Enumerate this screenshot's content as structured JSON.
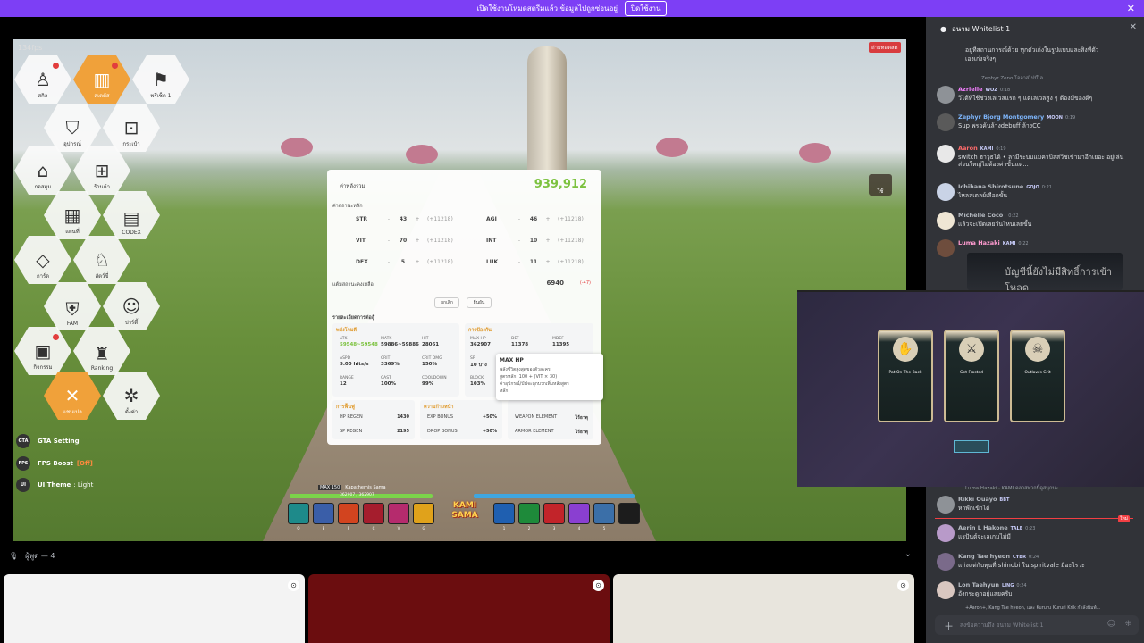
{
  "banner": {
    "text": "เปิดใช้งานโหมดสตรีมแล้ว ข้อมูลไปถูกซ่อนอยู่",
    "button": "ปิดใช้งาน",
    "close": "✕"
  },
  "game": {
    "fps": "134fps",
    "live_badge": "ถ่ายทอดสด",
    "top_right_button": "ใช้",
    "menu": [
      {
        "label": "สกิล",
        "icon": "person-icon",
        "glyph": "♙"
      },
      {
        "label": "สเตตัส",
        "icon": "bar-chart-icon",
        "glyph": "▥",
        "active": true
      },
      {
        "label": "พรีเซ็ต 1",
        "icon": "figure-icon",
        "glyph": "⚑"
      },
      {
        "label": "อุปกรณ์",
        "icon": "shield-icon",
        "glyph": "⛉"
      },
      {
        "label": "กระเป๋า",
        "icon": "bag-icon",
        "glyph": "⊡"
      },
      {
        "label": "กอสตูม",
        "icon": "shirt-icon",
        "glyph": "⌂"
      },
      {
        "label": "ร้านค้า",
        "icon": "shop-bag-icon",
        "glyph": "⊞"
      },
      {
        "label": "แผนที่",
        "icon": "map-icon",
        "glyph": "▦"
      },
      {
        "label": "CODEX",
        "icon": "book-icon",
        "glyph": "▤"
      },
      {
        "label": "การ์ด",
        "icon": "card-icon",
        "glyph": "◇"
      },
      {
        "label": "สัตว์ขี่",
        "icon": "mount-icon",
        "glyph": "♘"
      },
      {
        "label": "FAM",
        "icon": "family-shield-icon",
        "glyph": "⛨"
      },
      {
        "label": "ปาร์ตี้",
        "icon": "party-icon",
        "glyph": "☺"
      },
      {
        "label": "กิจกรรม",
        "icon": "calendar-icon",
        "glyph": "▣"
      },
      {
        "label": "Ranking",
        "icon": "ranking-icon",
        "glyph": "♜"
      },
      {
        "label": "แชนเปล",
        "icon": "swords-icon",
        "glyph": "✕",
        "active": true
      },
      {
        "label": "ตั้งค่า",
        "icon": "gear-icon",
        "glyph": "✲"
      }
    ],
    "options": [
      {
        "icon": "GTA",
        "label": "GTA Setting",
        "suffix": "",
        "extra": ""
      },
      {
        "icon": "FPS",
        "label": "FPS Boost",
        "suffix": "[Off]",
        "extra": ""
      },
      {
        "icon": "UI",
        "label": "UI Theme",
        "suffix": "",
        "extra": ": Light"
      }
    ],
    "stats": {
      "header": "ค่าพลังรวม",
      "total": "939,912",
      "sub": "ค่าสถานะหลัก",
      "rows": [
        {
          "name": "STR",
          "minus": "-",
          "value": "43",
          "plus": "+",
          "bonus": "(+11218)"
        },
        {
          "name": "AGI",
          "minus": "-",
          "value": "46",
          "plus": "+",
          "bonus": "(+11218)"
        },
        {
          "name": "VIT",
          "minus": "-",
          "value": "70",
          "plus": "+",
          "bonus": "(+11218)"
        },
        {
          "name": "INT",
          "minus": "-",
          "value": "10",
          "plus": "+",
          "bonus": "(+11218)"
        },
        {
          "name": "DEX",
          "minus": "-",
          "value": "5",
          "plus": "+",
          "bonus": "(+11218)"
        },
        {
          "name": "LUK",
          "minus": "-",
          "value": "11",
          "plus": "+",
          "bonus": "(+11218)"
        }
      ],
      "remaining_label": "แต้มสถานะคงเหลือ",
      "remaining_value": "6940",
      "remaining_delta": "(-47)",
      "cancel": "ยกเลิก",
      "confirm": "ยืนยัน",
      "detail_header": "รายละเอียดการต่อสู้",
      "attack": {
        "title": "พลังโจมตี",
        "cells": [
          {
            "k": "ATK",
            "v": "59548~59548",
            "hl": true
          },
          {
            "k": "MATK",
            "v": "59886~59886"
          },
          {
            "k": "HIT",
            "v": "28061"
          },
          {
            "k": "ASPD",
            "v": "5.00 hits/s"
          },
          {
            "k": "CRIT",
            "v": "3369%"
          },
          {
            "k": "CRIT DMG",
            "v": "150%"
          },
          {
            "k": "RANGE",
            "v": "12"
          },
          {
            "k": "CAST",
            "v": "100%"
          },
          {
            "k": "COOLDOWN",
            "v": "99%"
          }
        ]
      },
      "defense": {
        "title": "การป้องกัน",
        "cells": [
          {
            "k": "MAX HP",
            "v": "362907"
          },
          {
            "k": "DEF",
            "v": "11378"
          },
          {
            "k": "MDEF",
            "v": "11395"
          },
          {
            "k": "SP",
            "v": "10 บาง"
          },
          {
            "k": "BLOCK",
            "v": "103%"
          }
        ]
      },
      "recovery": {
        "title": "การฟื้นฟู",
        "rows": [
          {
            "k": "HP REGEN",
            "v": "1430"
          },
          {
            "k": "SP REGEN",
            "v": "2195"
          }
        ]
      },
      "progress": {
        "title": "ความก้าวหน้า",
        "rows": [
          {
            "k": "EXP BONUS",
            "v": "+50%"
          },
          {
            "k": "DROP BONUS",
            "v": "+50%"
          }
        ]
      },
      "element": {
        "rows": [
          {
            "k": "WEAPON ELEMENT",
            "v": "ไร้ธาตุ"
          },
          {
            "k": "ARMOR ELEMENT",
            "v": "ไร้ธาตุ"
          }
        ]
      }
    },
    "tooltip": {
      "title": "MAX HP",
      "line1": "พลังชีวิตสูงสุดของตัวละคร",
      "line2": "สูตรหลัก: 100 + (VIT × 30)",
      "line3": "ค่าอุปกรณ์/บัฟจะถูกบวกเพิ่มหลังสูตร",
      "line4": "หลัก"
    },
    "hotbar": {
      "level": "MAX 150",
      "name": "Kapathemis Sama",
      "hp": "362907 / 362907",
      "logo_top": "KAMI",
      "logo_bottom": "SAMA",
      "keys": [
        "Q",
        "E",
        "F",
        "C",
        "V",
        "G",
        "1",
        "2",
        "3",
        "4",
        "5"
      ]
    }
  },
  "voice": {
    "label": "ผู้พูด — 4",
    "caret": "⌄"
  },
  "chat": {
    "channel": "อนาม Whitelist 1",
    "close": "✕",
    "top_text_1": "อยู่ที่สถานการณ์ด้วย ทุกตัวเก่งในรูปแบบและสิ่งที่ตัว",
    "top_text_2": "เองเก่งจริงๆ",
    "reply_line": "Zephyr Zeno",
    "reply_text": "โจลาสไปป์ไล",
    "messages": [
      {
        "name": "Azrielle",
        "tag": "WOZ",
        "time": "0:18",
        "text": "วิไต้ที่ใช้ช่วงเลเวลแรก ๆ แต่เลเวลสูง ๆ ต้องมีของดีๆ",
        "color": "#f47fff",
        "av": "#8e9297"
      },
      {
        "name": "Zephyr Bjorg Montgomery",
        "tag": "MOON",
        "time": "0:19",
        "text": "Sup พรอค้นล้างdebuff ล้างCC",
        "color": "#7fb8ff",
        "av": "#5a5a5a"
      },
      {
        "name": "Aaron",
        "tag": "KAMI",
        "time": "0:19",
        "text": "switch ฮาวุธได้ • ลามีระบบแมคาบิลสวิชเข้ามาอีกเยอะ อยู่เล่นส่วนใหญ่ไม่ต้องค่าขั้นแต่...",
        "color": "#ff6b6b",
        "av": "#e8e8e8"
      },
      {
        "name": "Ichihana Shirotsune",
        "tag": "GOJO",
        "time": "0:21",
        "text": "ไหลสเตลย์เลือกขั้น",
        "color": "#b5bac1",
        "av": "#c9d3e6"
      },
      {
        "name": "Michelle Coco",
        "tag": "",
        "time": "0:22",
        "text": "แล้วจะเปิดเลยวันไหนเลยขั้น",
        "color": "#b5bac1",
        "av": "#efe6d4"
      },
      {
        "name": "Luma Hazaki",
        "tag": "KAMI",
        "time": "0:22",
        "text": "",
        "color": "#ff9bd0",
        "av": "#6e4d3d"
      }
    ],
    "embed_text": "บัญชีนี้ยังไม่มีสิทธิ์การเข้าโหลด",
    "lower_messages": [
      {
        "name": "Rikki Ouayo",
        "tag": "BBT",
        "time": "",
        "text": "หาพักเข้าได้",
        "color": "#b5bac1",
        "av": "#8e9297"
      },
      {
        "name": "Aerin L Hakone",
        "tag": "TALE",
        "time": "0:23",
        "text": "แรปันต์จะเลเกมไม่มี",
        "color": "#b5bac1",
        "av": "#b89ac9"
      },
      {
        "name": "Kang Tae hyeon",
        "tag": "CYBR",
        "time": "0:24",
        "text": "แก่งแต่กับทุนที่ shinobi ใน spiritvale มีอะไรวะ",
        "color": "#b5bac1",
        "av": "#7a6a8a"
      },
      {
        "name": "Lon Taehyun",
        "tag": "LING",
        "time": "0:24",
        "text": "อังกระดูกอยู่แลยครับ",
        "color": "#b5bac1",
        "av": "#d9c7c0"
      }
    ],
    "hazaki_line": "Luma Hazaki",
    "hazaki_tag": "KAMI",
    "hazaki_text": "คลาสพวกนี้ดูสนุกนะ",
    "typing": "+Aaron+, Kang Tae hyeon, และ Kururu Kururi Krik กำลังพิมพ์...",
    "new_label": "ใหม่",
    "input_placeholder": "ส่งข้อความถึง อนาม Whitelist 1"
  },
  "overlay": {
    "cards": [
      {
        "name": "Pat On The Back",
        "glyph": "✋"
      },
      {
        "name": "Get Frosted",
        "glyph": "⚔"
      },
      {
        "name": "Outlaw's Grit",
        "glyph": "☠"
      }
    ]
  }
}
